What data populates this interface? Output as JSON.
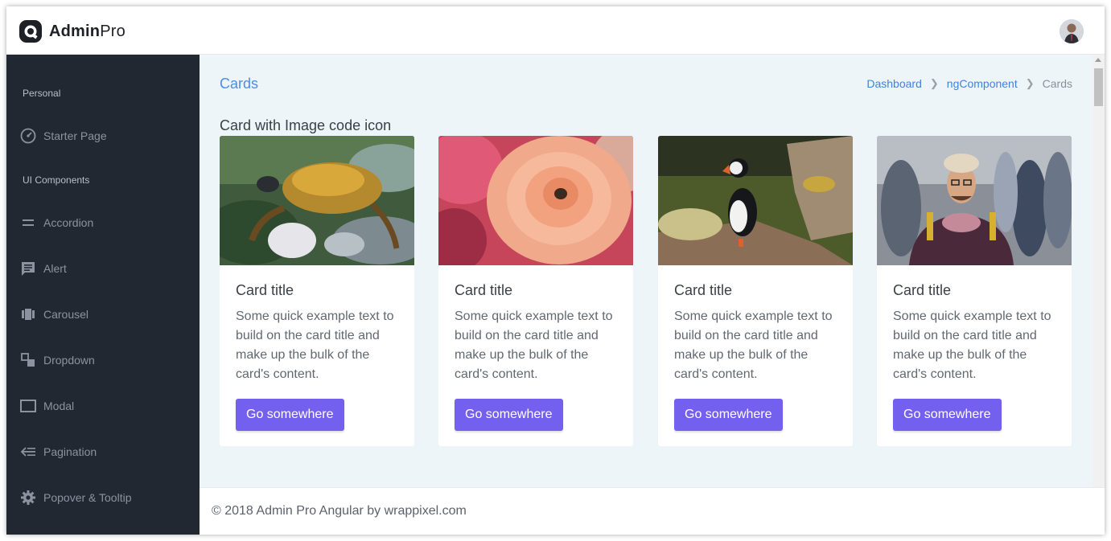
{
  "brand": {
    "name_bold": "Admin",
    "name_light": "Pro",
    "logo_icon": "admin-pro-logo-icon"
  },
  "header": {
    "avatar_icon": "user-avatar"
  },
  "sidebar": {
    "caption_personal": "Personal",
    "caption_ui": "UI Components",
    "items": [
      {
        "label": "Starter Page",
        "icon": "gauge-icon"
      },
      {
        "label": "Accordion",
        "icon": "equal-icon"
      },
      {
        "label": "Alert",
        "icon": "message-icon"
      },
      {
        "label": "Carousel",
        "icon": "carousel-icon"
      },
      {
        "label": "Dropdown",
        "icon": "dropdown-icon"
      },
      {
        "label": "Modal",
        "icon": "modal-icon"
      },
      {
        "label": "Pagination",
        "icon": "pagination-icon"
      },
      {
        "label": "Popover & Tooltip",
        "icon": "gear-icon"
      }
    ]
  },
  "page": {
    "title": "Cards",
    "breadcrumb": [
      "Dashboard",
      "ngComponent",
      "Cards"
    ],
    "section_title": "Card with Image code icon"
  },
  "cards": [
    {
      "image": "crab-photo",
      "title": "Card title",
      "text": "Some quick example text to build on the card title and make up the bulk of the card's content.",
      "button": "Go somewhere"
    },
    {
      "image": "rose-photo",
      "title": "Card title",
      "text": "Some quick example text to build on the card title and make up the bulk of the card's content.",
      "button": "Go somewhere"
    },
    {
      "image": "puffin-photo",
      "title": "Card title",
      "text": "Some quick example text to build on the card title and make up the bulk of the card's content.",
      "button": "Go somewhere"
    },
    {
      "image": "man-portrait-photo",
      "title": "Card title",
      "text": "Some quick example text to build on the card title and make up the bulk of the card's content.",
      "button": "Go somewhere"
    }
  ],
  "footer": {
    "text": "© 2018 Admin Pro Angular by wrappixel.com"
  },
  "colors": {
    "sidebar_bg": "#222831",
    "accent_button": "#7460ee",
    "link": "#3f82de",
    "page_bg": "#eef5f9"
  }
}
